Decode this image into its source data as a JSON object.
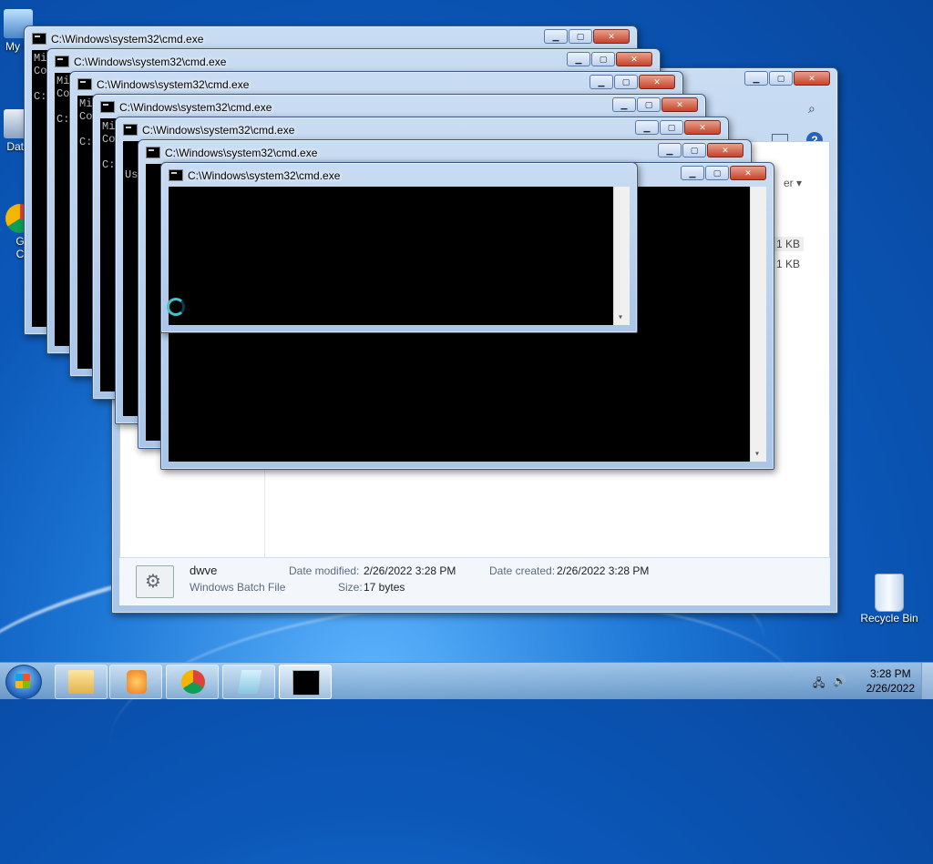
{
  "desktop": {
    "icons": [
      {
        "label": "My C"
      },
      {
        "label": "Data"
      },
      {
        "label": "G"
      },
      {
        "label": "C"
      }
    ],
    "recycle_bin": "Recycle Bin"
  },
  "explorer": {
    "size_col_1": "1 KB",
    "size_col_2": "1 KB",
    "view_hint": "er ▾",
    "details": {
      "name": "dwve",
      "type": "Windows Batch File",
      "date_modified_label": "Date modified:",
      "date_modified": "2/26/2022 3:28 PM",
      "date_created_label": "Date created:",
      "date_created": "2/26/2022 3:28 PM",
      "size_label": "Size:",
      "size": "17 bytes"
    }
  },
  "cmd_windows": [
    {
      "title": "C:\\Windows\\system32\\cmd.exe",
      "text": "Mi\nCo\n\nC:"
    },
    {
      "title": "C:\\Windows\\system32\\cmd.exe",
      "text": "Mi\nCo\n\nC:"
    },
    {
      "title": "C:\\Windows\\system32\\cmd.exe",
      "text": "Mi\nCo\n\nC:"
    },
    {
      "title": "C:\\Windows\\system32\\cmd.exe",
      "text": "Mi\nCo\n\nC:"
    },
    {
      "title": "C:\\Windows\\system32\\cmd.exe",
      "text": "\n\nUs"
    },
    {
      "title": "C:\\Windows\\system32\\cmd.exe",
      "text": ""
    },
    {
      "title": "C:\\Windows\\system32\\cmd.exe",
      "text": ""
    }
  ],
  "window_controls": {
    "minimize": "▁",
    "maximize": "▢",
    "close": "✕"
  },
  "taskbar": {
    "time": "3:28 PM",
    "date": "2/26/2022",
    "pinned": [
      "explorer-icon",
      "media-player-icon",
      "chrome-icon",
      "notepad-icon",
      "cmd-icon"
    ]
  },
  "colors": {
    "accent": "#1e78d6",
    "console_bg": "#000000",
    "close_red": "#c7432a"
  }
}
